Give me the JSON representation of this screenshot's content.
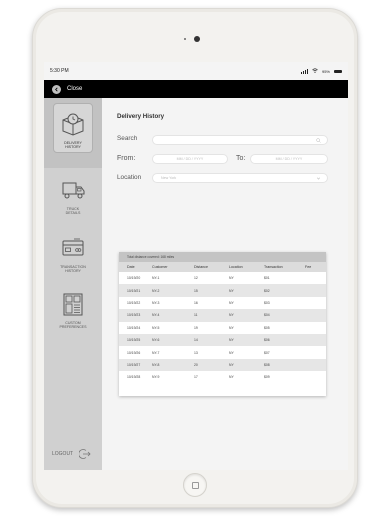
{
  "status_bar": {
    "time": "5:30 PM",
    "battery": "95%"
  },
  "top_bar": {
    "close_label": "Close"
  },
  "sidebar": {
    "items": [
      {
        "label_line1": "DELIVERY",
        "label_line2": "HISTORY",
        "icon": "delivery-box-icon",
        "active": true
      },
      {
        "label_line1": "TRUCK",
        "label_line2": "DETAILS",
        "icon": "truck-icon",
        "active": false
      },
      {
        "label_line1": "TRANSACTION",
        "label_line2": "HISTORY",
        "icon": "card-icon",
        "active": false
      },
      {
        "label_line1": "CUSTOM",
        "label_line2": "PREFERENCES",
        "icon": "layout-grid-icon",
        "active": false
      }
    ],
    "logout_label": "LOGOUT"
  },
  "main": {
    "title": "Delivery History",
    "search_label": "Search",
    "from_label": "From:",
    "from_placeholder": "MM / DD / YYYY",
    "to_label": "To:",
    "to_placeholder": "MM / DD / YYYY",
    "location_label": "Location",
    "location_placeholder": "New York"
  },
  "table": {
    "caption": "Total distance covered: 168 miles",
    "headers": [
      "Date",
      "Customer",
      "Distance",
      "Location",
      "Transaction",
      "Fee"
    ],
    "rows": [
      [
        "10/19/20",
        "NY-1",
        "12",
        "NY",
        "$01",
        ""
      ],
      [
        "10/19/21",
        "NY-2",
        "15",
        "NY",
        "$02",
        ""
      ],
      [
        "10/19/22",
        "NY-3",
        "16",
        "NY",
        "$03",
        ""
      ],
      [
        "10/19/23",
        "NY-4",
        "11",
        "NY",
        "$04",
        ""
      ],
      [
        "10/19/24",
        "NY-5",
        "19",
        "NY",
        "$05",
        ""
      ],
      [
        "10/19/25",
        "NY-6",
        "14",
        "NY",
        "$06",
        ""
      ],
      [
        "10/19/26",
        "NY-7",
        "13",
        "NY",
        "$07",
        ""
      ],
      [
        "10/19/27",
        "NY-8",
        "20",
        "NY",
        "$08",
        ""
      ],
      [
        "10/19/28",
        "NY-9",
        "17",
        "NY",
        "$09",
        ""
      ]
    ]
  }
}
